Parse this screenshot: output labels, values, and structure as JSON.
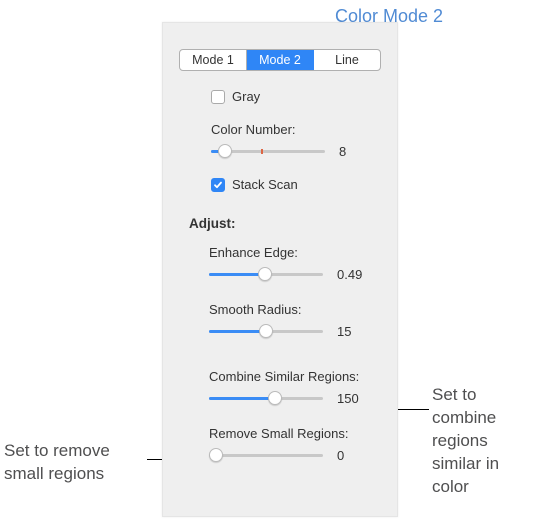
{
  "callouts": {
    "mode2_title": "Color Mode 2",
    "remove_text": "Set to remove small regions",
    "combine_text": "Set to combine regions similar in color"
  },
  "seg": {
    "mode1": "Mode 1",
    "mode2": "Mode 2",
    "line": "Line",
    "active": "mode2"
  },
  "options": {
    "gray_label": "Gray",
    "gray_checked": false,
    "color_number_label": "Color Number:",
    "color_number_value": "8",
    "color_number_fill_pct": 12,
    "color_number_tick_pct": 44,
    "stack_scan_label": "Stack Scan",
    "stack_scan_checked": true
  },
  "adjust": {
    "heading": "Adjust:",
    "enhance_edge_label": "Enhance Edge:",
    "enhance_edge_value": "0.49",
    "enhance_edge_fill_pct": 49,
    "smooth_radius_label": "Smooth Radius:",
    "smooth_radius_value": "15",
    "smooth_radius_fill_pct": 50,
    "combine_similar_label": "Combine Similar Regions:",
    "combine_similar_value": "150",
    "combine_similar_fill_pct": 58,
    "remove_small_label": "Remove Small Regions:",
    "remove_small_value": "0",
    "remove_small_fill_pct": 0
  }
}
